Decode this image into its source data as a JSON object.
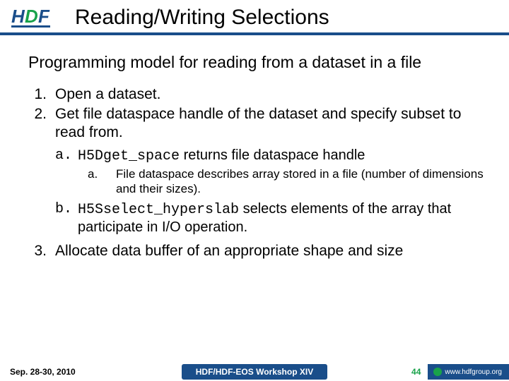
{
  "header": {
    "title": "Reading/Writing Selections",
    "logo_alt": "HDF"
  },
  "body": {
    "intro": "Programming model for reading from a dataset in a file",
    "step1_num": "1.",
    "step1": "Open a dataset.",
    "step2_num": "2.",
    "step2": "Get file dataspace handle of the dataset and specify subset to read from.",
    "step2a_num": "a.",
    "step2a_code": "H5Dget_space",
    "step2a_rest": " returns file dataspace handle",
    "step2a_sub_num": "a.",
    "step2a_sub": "File dataspace describes array stored in a file (number of dimensions and their sizes).",
    "step2b_num": "b.",
    "step2b_code": "H5Sselect_hyperslab",
    "step2b_rest": " selects elements of the array that participate in I/O operation.",
    "step3_num": "3.",
    "step3": "Allocate data buffer of an appropriate shape and size"
  },
  "footer": {
    "date": "Sep. 28-30, 2010",
    "center": "HDF/HDF-EOS Workshop XIV",
    "page": "44",
    "site": "www.hdfgroup.org"
  }
}
